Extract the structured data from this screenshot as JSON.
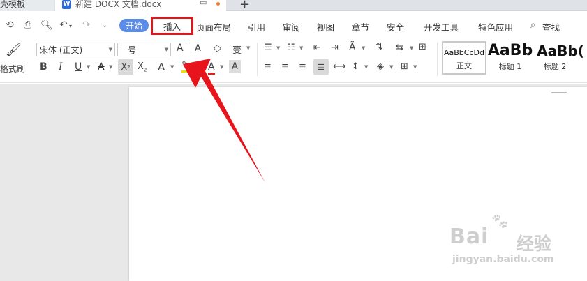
{
  "tabbar": {
    "tab1_label": "稿壳模板",
    "tab2_label": "新建 DOCX 文档.docx",
    "tab2_icon": "W",
    "new_tab_glyph": "+"
  },
  "menubar": {
    "items": {
      "start": "开始",
      "insert": "插入",
      "layout": "页面布局",
      "reference": "引用",
      "review": "审阅",
      "view": "视图",
      "chapter": "章节",
      "security": "安全",
      "developer": "开发工具",
      "special": "特色应用",
      "search": "查找"
    },
    "accent_color": "#5b8ce8",
    "highlight_border_color": "#d41b20"
  },
  "ribbon": {
    "format_painter_label": "格式刷",
    "font_name": "宋体 (正文)",
    "font_size": "一号",
    "styles": [
      {
        "sample": "AaBbCcDd",
        "label": "正文"
      },
      {
        "sample": "AaBb",
        "label": "标题 1"
      },
      {
        "sample": "AaBb(",
        "label": "标题 2"
      }
    ],
    "icons": {
      "bold": "B",
      "italic": "I",
      "underline": "U",
      "strikethrough": "A",
      "superscript": "X",
      "subscript": "X",
      "text_effect": "A",
      "font_color": "A",
      "char_shading": "A",
      "grow_font": "A",
      "shrink_font": "A",
      "phonetic": "变"
    }
  },
  "watermark": {
    "brand": "Bai",
    "brand_suffix": "经验",
    "url": "jingyan.baidu.com"
  },
  "annotation": {
    "arrow_color": "#e8141b"
  }
}
